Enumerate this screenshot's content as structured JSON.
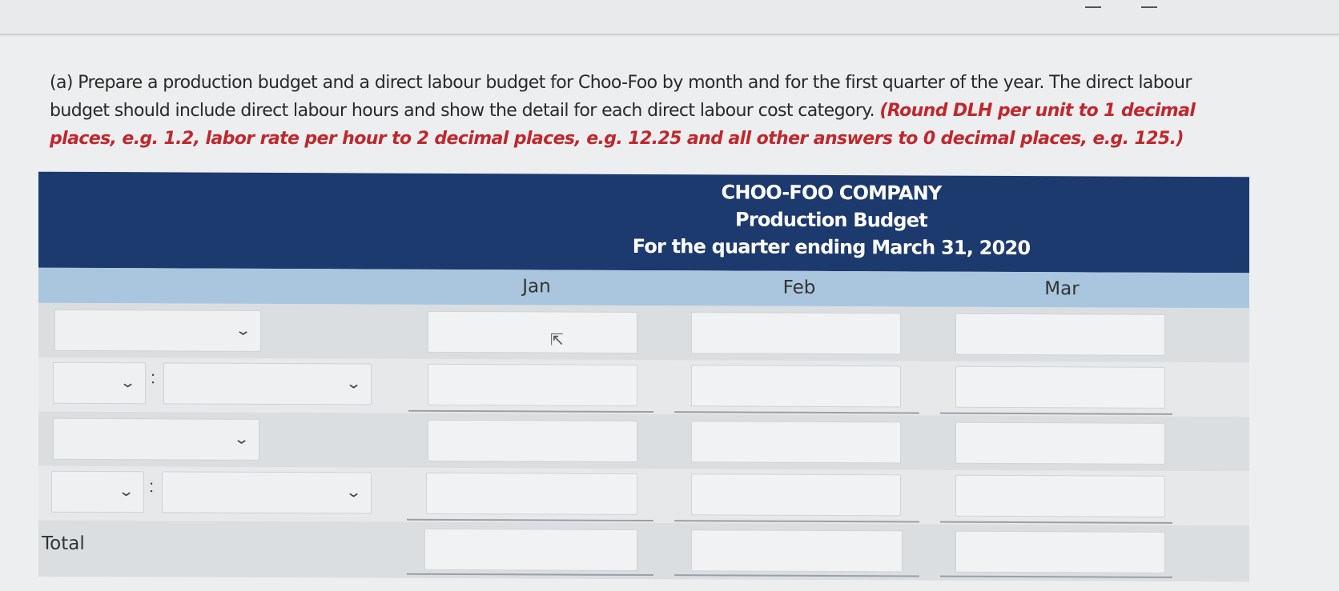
{
  "question": {
    "label": "(a)",
    "text": "Prepare a production budget and a direct labour budget for Choo-Foo by month and for the first quarter of the year. The direct labour budget should include direct labour hours and show the detail for each direct labour cost category.",
    "hint": "(Round DLH per unit to 1 decimal places, e.g. 1.2, labor rate per hour to 2 decimal places, e.g. 12.25 and all other answers to 0 decimal places, e.g. 125.)"
  },
  "budget": {
    "company": "CHOO-FOO COMPANY",
    "title": "Production Budget",
    "period": "For the quarter ending March 31, 2020",
    "columns": [
      "Jan",
      "Feb",
      "Mar"
    ],
    "total_label": "Total",
    "dropdown_chevron": "chevron-down-icon",
    "colon": ":"
  },
  "colors": {
    "header_bg": "#1d3a6e",
    "column_bar": "#a9c6de",
    "hint_red": "#c0272d"
  }
}
